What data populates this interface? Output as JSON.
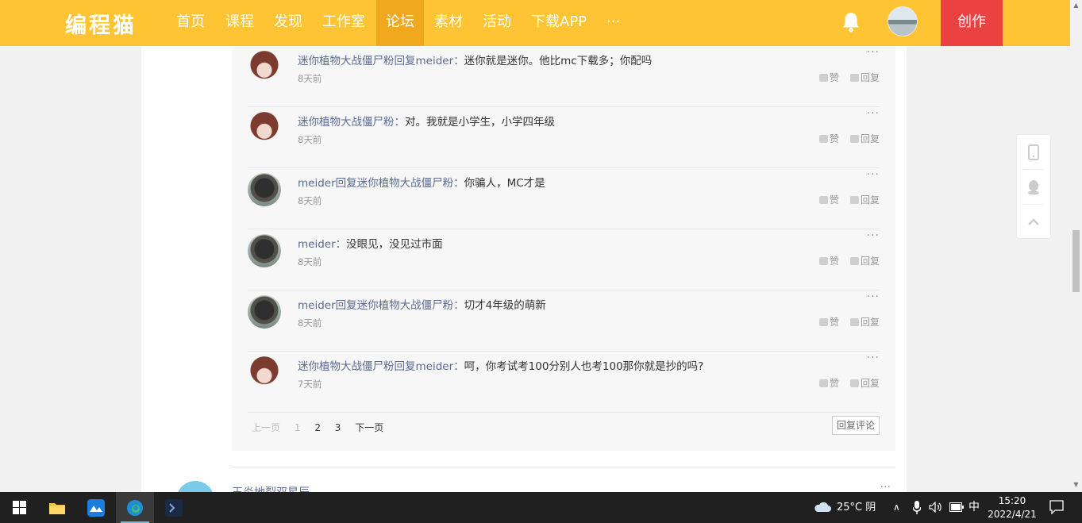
{
  "header": {
    "logo": "编程猫",
    "nav": [
      "首页",
      "课程",
      "发现",
      "工作室",
      "论坛",
      "素材",
      "活动",
      "下载APP",
      "···"
    ],
    "active_index": 4,
    "create_label": "创作"
  },
  "replies": [
    {
      "name": "迷你植物大战僵尸粉",
      "reply_word": "回复",
      "target": "meider",
      "text": "迷你就是迷你。他比mc下载多；你配吗",
      "time": "8天前",
      "avatar": "girl"
    },
    {
      "name": "迷你植物大战僵尸粉",
      "reply_word": "",
      "target": "",
      "text": "对。我就是小学生，小学四年级",
      "time": "8天前",
      "avatar": "girl"
    },
    {
      "name": "meider",
      "reply_word": "回复",
      "target": "迷你植物大战僵尸粉",
      "text": "你骗人，MC才是",
      "time": "8天前",
      "avatar": "dark"
    },
    {
      "name": "meider",
      "reply_word": "",
      "target": "",
      "text": "没眼见，没见过市面",
      "time": "8天前",
      "avatar": "dark"
    },
    {
      "name": "meider",
      "reply_word": "回复",
      "target": "迷你植物大战僵尸粉",
      "text": "切才4年级的萌新",
      "time": "8天前",
      "avatar": "dark"
    },
    {
      "name": "迷你植物大战僵尸粉",
      "reply_word": "回复",
      "target": "meider",
      "text": "呵，你考试考100分别人也考100那你就是抄的吗?",
      "time": "7天前",
      "avatar": "girl"
    }
  ],
  "actions": {
    "more": "···",
    "like": "赞",
    "reply": "回复"
  },
  "pagination": {
    "prev": "上一页",
    "pages": [
      "1",
      "2",
      "3"
    ],
    "current": "1",
    "next": "下一页"
  },
  "reply_comment_label": "回复评论",
  "next_comment": {
    "name": "王炎地裂双星辰",
    "more": "···"
  },
  "taskbar": {
    "weather": "25°C 阴",
    "ime": "中",
    "time": "15:20",
    "date": "2022/4/21",
    "icons": [
      "windows-start-icon",
      "file-explorer-icon",
      "app-icon",
      "edge-icon",
      "terminal-icon"
    ]
  },
  "colors": {
    "brand": "#fec433",
    "nav_active": "#f0a91e",
    "create": "#ec4141",
    "name_link": "#5b6a92"
  }
}
